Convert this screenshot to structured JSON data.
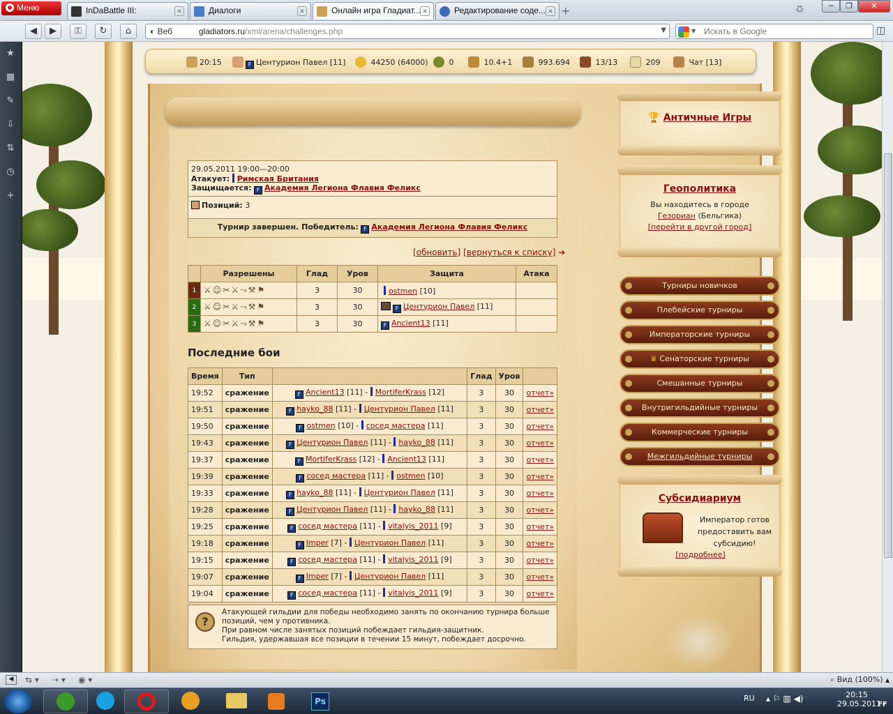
{
  "browser": {
    "menu_label": "Меню",
    "tabs": [
      {
        "title": "InDaBattle III:"
      },
      {
        "title": "Диалоги"
      },
      {
        "title": "Онлайн игра Гладиат..."
      },
      {
        "title": "Редактирование соде..."
      }
    ],
    "address": {
      "scheme_label": "Веб",
      "host": "gladiators.ru",
      "path": "/xml/arena/challenges.php"
    },
    "search_placeholder": "Искать в Google",
    "status_zoom": "Вид (100%)"
  },
  "topbar": {
    "time": "20:15",
    "player": "Центурион Павел [11]",
    "experience": "44250 (64000)",
    "wreaths": "0",
    "stat": "10.4+1",
    "gold": "993.694",
    "fights": "13/13",
    "mail": "209",
    "chat": "Чат [13]"
  },
  "tournament": {
    "date": "29.05.2011 19:00—20:00",
    "attacks_label": "Атакует:",
    "attacker": "Римская Британия",
    "defends_label": "Защищается:",
    "defender": "Академия Легиона Флавия Феликс",
    "positions_label": "Позиций:",
    "positions": "3",
    "result_label": "Турнир завершен. Победитель:",
    "winner": "Академия Легиона Флавия Феликс",
    "refresh": "[обновить]",
    "back": "[вернуться к списку]"
  },
  "positions_table": {
    "headers": [
      "Разрешены",
      "Глад",
      "Уров",
      "Защита",
      "Атака"
    ],
    "rows": [
      {
        "num": "1",
        "glad": "3",
        "level": "30",
        "defender": "ostmen",
        "def_level": "[10]",
        "attack": ""
      },
      {
        "num": "2",
        "glad": "3",
        "level": "30",
        "defender": "Центурион Павел",
        "def_level": "[11]",
        "attack": ""
      },
      {
        "num": "3",
        "glad": "3",
        "level": "30",
        "defender": "Ancient13",
        "def_level": "[11]",
        "attack": ""
      }
    ]
  },
  "recent": {
    "title": "Последние бои",
    "headers": [
      "Время",
      "Тип",
      "",
      "Глад",
      "Уров",
      ""
    ],
    "report_label": "отчет»",
    "rows": [
      {
        "time": "19:52",
        "type": "сражение",
        "p1": "Ancient13",
        "l1": "[11]",
        "p2": "MortiferKrass",
        "l2": "[12]",
        "glad": "3",
        "lvl": "30"
      },
      {
        "time": "19:51",
        "type": "сражение",
        "p1": "hayko_88",
        "l1": "[11]",
        "p2": "Центурион Павел",
        "l2": "[11]",
        "glad": "3",
        "lvl": "30"
      },
      {
        "time": "19:50",
        "type": "сражение",
        "p1": "ostmen",
        "l1": "[10]",
        "p2": "сосед мастера",
        "l2": "[11]",
        "glad": "3",
        "lvl": "30"
      },
      {
        "time": "19:43",
        "type": "сражение",
        "p1": "Центурион Павел",
        "l1": "[11]",
        "p2": "hayko_88",
        "l2": "[11]",
        "glad": "3",
        "lvl": "30"
      },
      {
        "time": "19:37",
        "type": "сражение",
        "p1": "MortiferKrass",
        "l1": "[12]",
        "p2": "Ancient13",
        "l2": "[11]",
        "glad": "3",
        "lvl": "30"
      },
      {
        "time": "19:39",
        "type": "сражение",
        "p1": "сосед мастера",
        "l1": "[11]",
        "p2": "ostmen",
        "l2": "[10]",
        "glad": "3",
        "lvl": "30"
      },
      {
        "time": "19:33",
        "type": "сражение",
        "p1": "hayko_88",
        "l1": "[11]",
        "p2": "Центурион Павел",
        "l2": "[11]",
        "glad": "3",
        "lvl": "30"
      },
      {
        "time": "19:28",
        "type": "сражение",
        "p1": "Центурион Павел",
        "l1": "[11]",
        "p2": "hayko_88",
        "l2": "[11]",
        "glad": "3",
        "lvl": "30"
      },
      {
        "time": "19:25",
        "type": "сражение",
        "p1": "сосед мастера",
        "l1": "[11]",
        "p2": "vitalyis_2011",
        "l2": "[9]",
        "glad": "3",
        "lvl": "30"
      },
      {
        "time": "19:18",
        "type": "сражение",
        "p1": "Imper",
        "l1": "[7]",
        "p2": "Центурион Павел",
        "l2": "[11]",
        "glad": "3",
        "lvl": "30"
      },
      {
        "time": "19:15",
        "type": "сражение",
        "p1": "сосед мастера",
        "l1": "[11]",
        "p2": "vitalyis_2011",
        "l2": "[9]",
        "glad": "3",
        "lvl": "30"
      },
      {
        "time": "19:07",
        "type": "сражение",
        "p1": "Imper",
        "l1": "[7]",
        "p2": "Центурион Павел",
        "l2": "[11]",
        "glad": "3",
        "lvl": "30"
      },
      {
        "time": "19:04",
        "type": "сражение",
        "p1": "сосед мастера",
        "l1": "[11]",
        "p2": "vitalyis_2011",
        "l2": "[9]",
        "glad": "3",
        "lvl": "30"
      }
    ]
  },
  "info_note": [
    "Атакующей гильдии для победы необходимо занять по окончанию турнира больше",
    "позиций, чем у противника.",
    "При равном числе занятых позиций побеждает гильдия-защитник.",
    "Гильдия, удержавшая все позиции в течении 15 минут, побеждает досрочно."
  ],
  "right": {
    "ancient_games": "Античные Игры",
    "geo_title": "Геополитика",
    "geo_text": "Вы находитесь в городе",
    "geo_city": "Гезориан",
    "geo_country": "(Бельгика)",
    "geo_link": "[перейти в другой город]",
    "tournaments": [
      "Турниры новичков",
      "Плебейские турниры",
      "Императорские турниры",
      "Сенаторские турниры",
      "Смешанные турниры",
      "Внутригильдийные турниры",
      "Коммерческие турниры",
      "Межгильдийные турниры"
    ],
    "subsid_title": "Субсидиариум",
    "subsid_lines": [
      "Император готов",
      "предоставить вам",
      "субсидию!"
    ],
    "subsid_link": "[подробнее]"
  },
  "taskbar": {
    "lang": "RU",
    "time": "20:15",
    "date": "29.05.2011",
    "ff": "FF"
  }
}
